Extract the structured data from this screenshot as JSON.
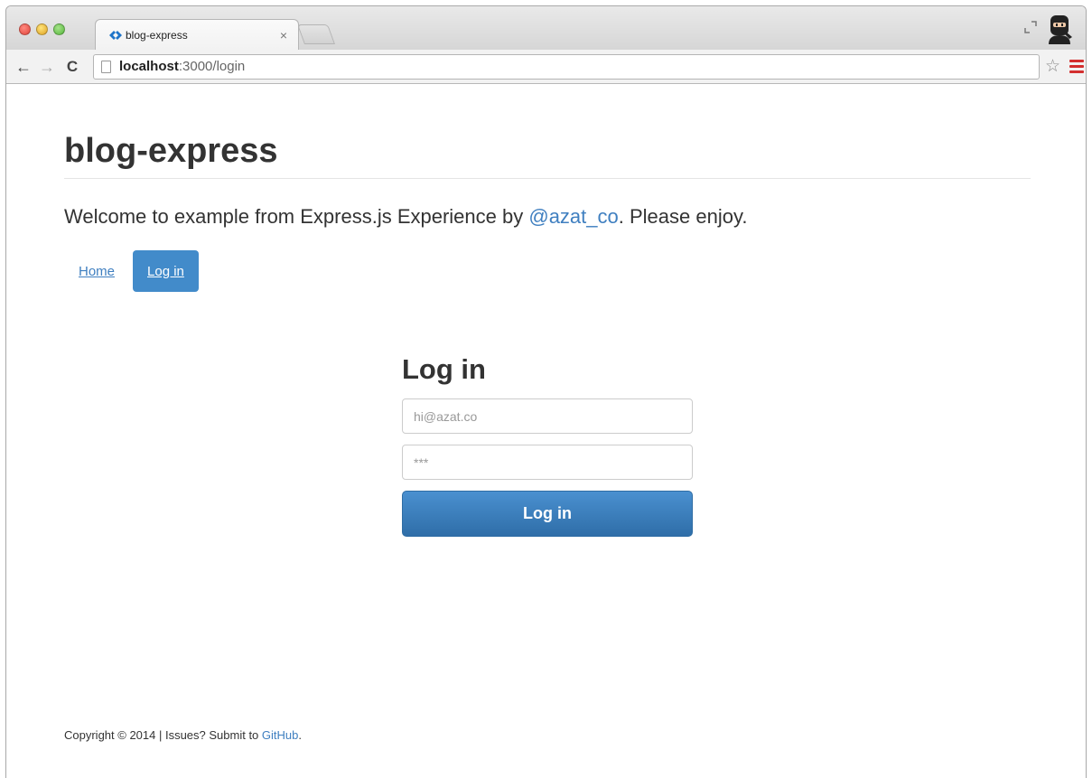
{
  "browser": {
    "tab_title": "blog-express",
    "tab_close": "×",
    "url_host": "localhost",
    "url_rest": ":3000/login"
  },
  "page": {
    "site_title": "blog-express",
    "welcome_prefix": "Welcome to example from Express.js Experience by ",
    "welcome_link": "@azat_co",
    "welcome_suffix": ". Please enjoy.",
    "nav": {
      "home": "Home",
      "login": "Log in"
    },
    "login": {
      "heading": "Log in",
      "email_placeholder": "hi@azat.co",
      "password_placeholder": "***",
      "submit_label": "Log in"
    },
    "footer": {
      "prefix": "Copyright © 2014 | Issues? Submit to ",
      "link": "GitHub",
      "suffix": "."
    }
  },
  "colors": {
    "link": "#3f7fc0",
    "primary": "#428bca"
  }
}
